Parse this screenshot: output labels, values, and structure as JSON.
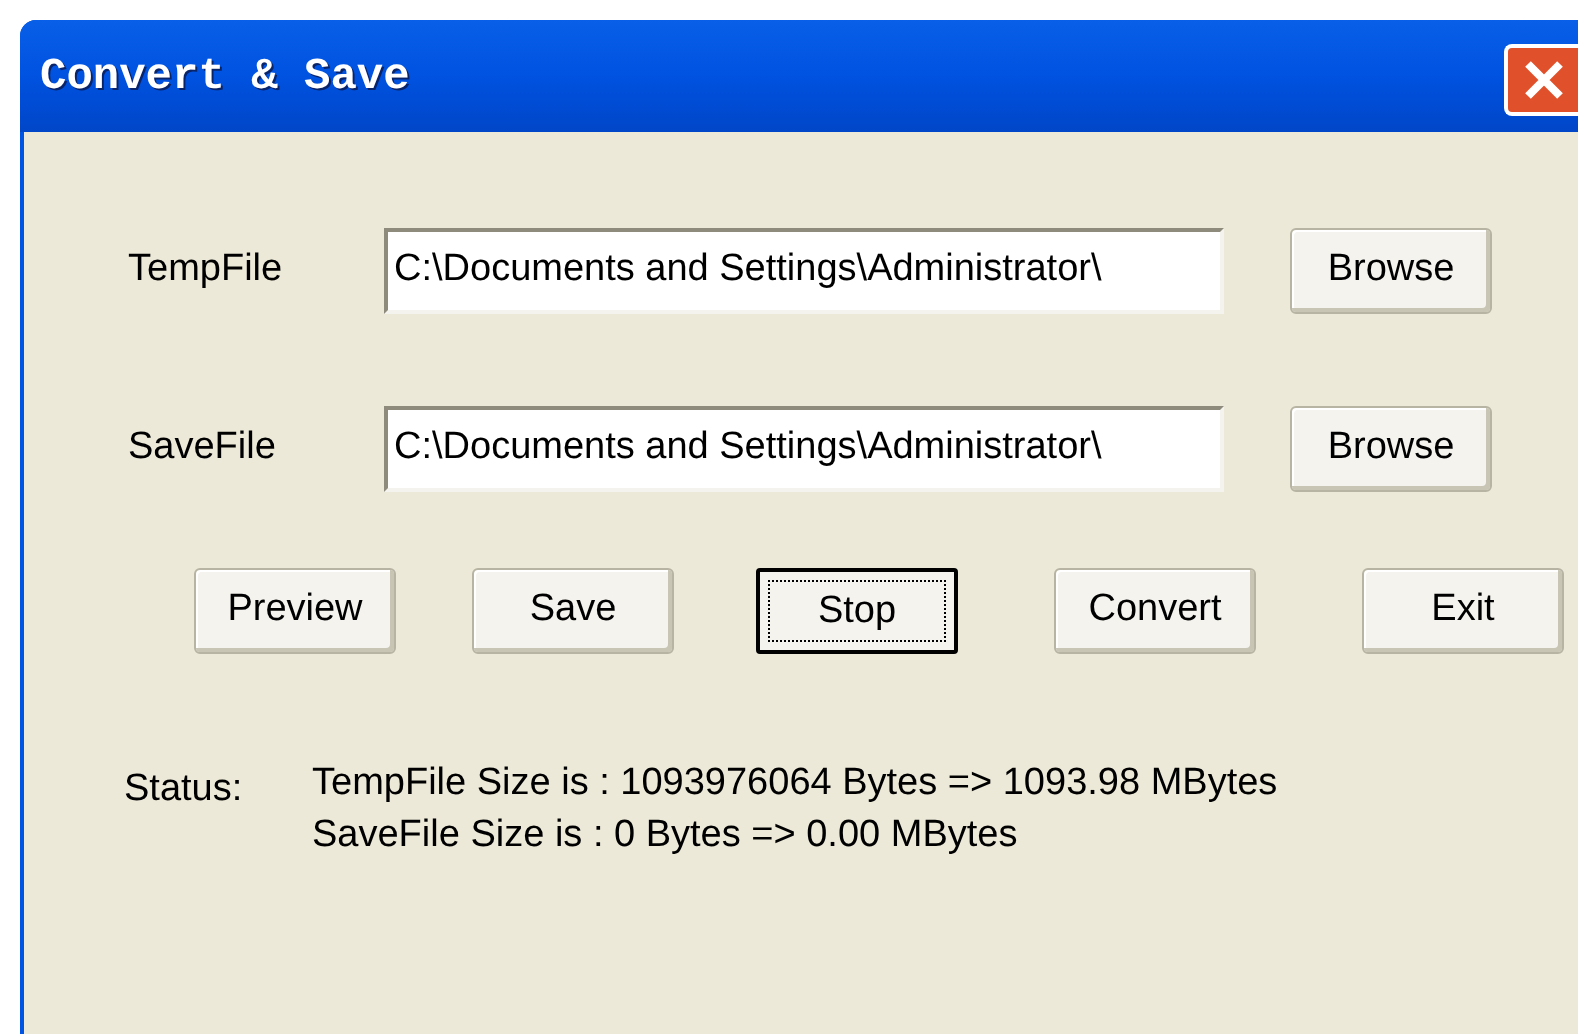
{
  "window": {
    "title": "Convert & Save"
  },
  "fields": [
    {
      "label": "TempFile",
      "value": "C:\\Documents and Settings\\Administrator\\",
      "button": "Browse"
    },
    {
      "label": "SaveFile",
      "value": "C:\\Documents and Settings\\Administrator\\",
      "button": "Browse"
    }
  ],
  "buttons": [
    {
      "label": "Preview",
      "focused": false
    },
    {
      "label": "Save",
      "focused": false
    },
    {
      "label": "Stop",
      "focused": true
    },
    {
      "label": "Convert",
      "focused": false
    },
    {
      "label": "Exit",
      "focused": false
    }
  ],
  "status": {
    "label": "Status:",
    "lines": [
      "TempFile Size is : 1093976064 Bytes => 1093.98 MBytes",
      "SaveFile Size is : 0 Bytes => 0.00 MBytes"
    ]
  }
}
